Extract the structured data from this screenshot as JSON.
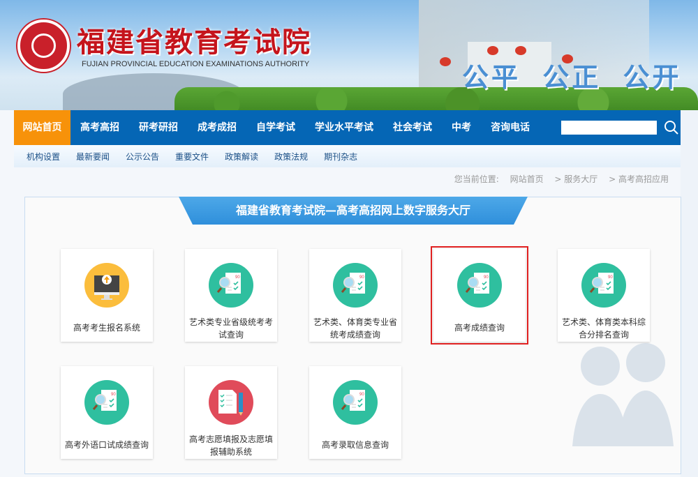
{
  "header": {
    "title": "福建省教育考试院",
    "subtitle": "FUJIAN PROVINCIAL EDUCATION EXAMINATIONS AUTHORITY",
    "slogan": "公平 公正 公开"
  },
  "nav": {
    "items": [
      "网站首页",
      "高考高招",
      "研考研招",
      "成考成招",
      "自学考试",
      "学业水平考试",
      "社会考试",
      "中考",
      "咨询电话"
    ],
    "active": 0,
    "search_value": ""
  },
  "subnav": {
    "items": [
      "机构设置",
      "最新要闻",
      "公示公告",
      "重要文件",
      "政策解读",
      "政策法规",
      "期刊杂志"
    ]
  },
  "breadcrumb": {
    "label": "您当前位置:",
    "items": [
      "网站首页",
      "> 服务大厅",
      "> 高考高招应用"
    ]
  },
  "main": {
    "title": "福建省教育考试院—高考高招网上数字服务大厅",
    "tiles": [
      {
        "label": "高考考生报名系统",
        "icon": "computer-upload-icon"
      },
      {
        "label": "艺术类专业省级统考考试查询",
        "icon": "score-search-icon"
      },
      {
        "label": "艺术类、体育类专业省统考成绩查询",
        "icon": "score-search-icon"
      },
      {
        "label": "高考成绩查询",
        "icon": "score-search-icon",
        "selected": true
      },
      {
        "label": "艺术类、体育类本科综合分排名查询",
        "icon": "score-search-icon"
      },
      {
        "label": "高考外语口试成绩查询",
        "icon": "score-search-icon"
      },
      {
        "label": "高考志愿填报及志愿填报辅助系统",
        "icon": "checklist-pencil-icon"
      },
      {
        "label": "高考录取信息查询",
        "icon": "score-search-icon"
      }
    ]
  },
  "colors": {
    "nav": "#0566b5",
    "active": "#f7920a",
    "teal": "#2fbf9f",
    "yellow": "#fbbd3c",
    "red": "#e04b5a",
    "highlight": "#e02020"
  }
}
